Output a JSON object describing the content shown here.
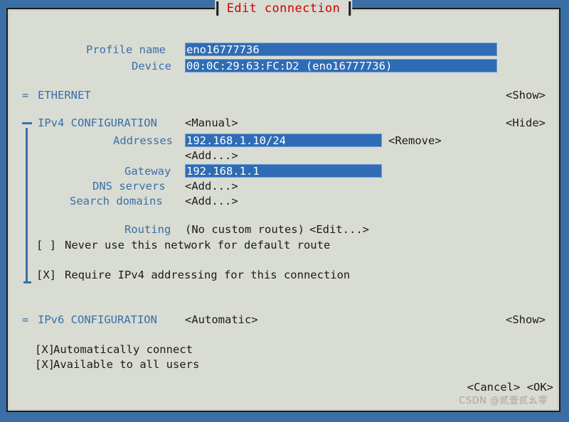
{
  "window": {
    "title": "Edit connection",
    "title_color": "#cc0000",
    "background": "#d9dcd3",
    "screen_background": "#3a6ea5"
  },
  "colors": {
    "label": "#3a6fa8",
    "text": "#1b1b1b",
    "field_bg": "#2f6cb5",
    "field_text": "#ffffff"
  },
  "profile": {
    "name_label": "Profile name",
    "name_value": "eno16777736",
    "name_fill": "___________________________",
    "device_label": "Device",
    "device_value": "00:0C:29:63:FC:D2 (eno16777736)",
    "device_fill": "_________"
  },
  "ethernet": {
    "marker": "=",
    "title": "ETHERNET",
    "toggle": "<Show>"
  },
  "ipv4": {
    "marker": "⊤",
    "title": "IPv4 CONFIGURATION",
    "method": "<Manual>",
    "toggle": "<Hide>",
    "addresses_label": "Addresses",
    "addresses_value": "192.168.1.10/24",
    "addresses_fill": "_________",
    "addresses_remove": "<Remove>",
    "addresses_add": "<Add...>",
    "gateway_label": "Gateway",
    "gateway_value": "192.168.1.1",
    "gateway_fill": "____________",
    "dns_label": "DNS servers",
    "dns_add": "<Add...>",
    "search_label": "Search domains",
    "search_add": "<Add...>",
    "routing_label": "Routing",
    "routing_value": "(No custom routes)",
    "routing_edit": "<Edit...>",
    "never_default_checkbox": "[ ]",
    "never_default_label": "Never use this network for default route",
    "require_checkbox": "[X]",
    "require_label": "Require IPv4 addressing for this connection"
  },
  "ipv6": {
    "marker": "=",
    "title": "IPv6 CONFIGURATION",
    "method": "<Automatic>",
    "toggle": "<Show>"
  },
  "options": {
    "autoconnect_checkbox": "[X]",
    "autoconnect_label": "Automatically connect",
    "allusers_checkbox": "[X]",
    "allusers_label": "Available to all users"
  },
  "buttons": {
    "cancel": "<Cancel>",
    "ok": "<OK>"
  },
  "watermark": {
    "text": "CSDN @贰壹贰幺零"
  }
}
